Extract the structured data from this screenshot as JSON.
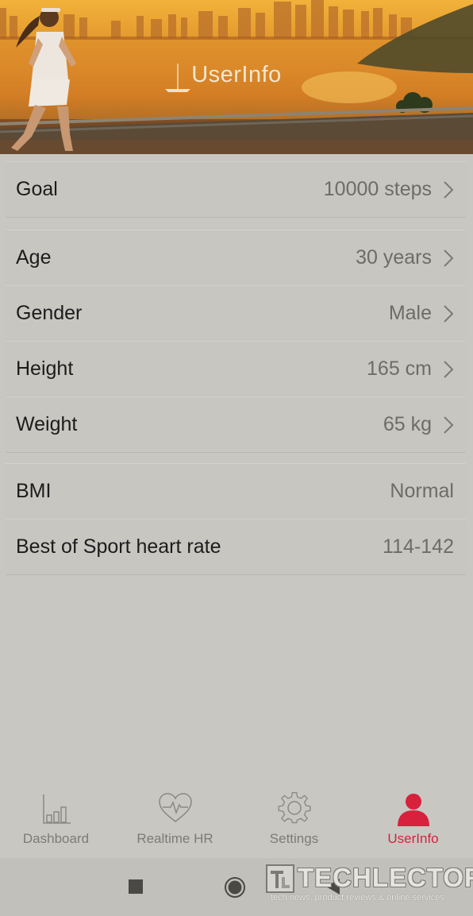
{
  "header": {
    "title": "UserInfo"
  },
  "goal_section": [
    {
      "label": "Goal",
      "value": "10000 steps"
    }
  ],
  "profile_section": [
    {
      "label": "Age",
      "value": "30 years"
    },
    {
      "label": "Gender",
      "value": "Male"
    },
    {
      "label": "Height",
      "value": "165 cm"
    },
    {
      "label": "Weight",
      "value": "65 kg"
    }
  ],
  "info_section": [
    {
      "label": "BMI",
      "value": "Normal"
    },
    {
      "label": "Best of Sport heart rate",
      "value": "114-142"
    }
  ],
  "tabs": [
    {
      "label": "Dashboard",
      "icon": "bar-chart-icon",
      "active": false
    },
    {
      "label": "Realtime HR",
      "icon": "heart-pulse-icon",
      "active": false
    },
    {
      "label": "Settings",
      "icon": "gear-icon",
      "active": false
    },
    {
      "label": "UserInfo",
      "icon": "user-icon",
      "active": true
    }
  ],
  "colors": {
    "accent": "#d8213d",
    "background": "#c9c7c2"
  },
  "watermark": {
    "brand": "TECHLECTOR",
    "tagline": "tech news, product reviews & online services"
  }
}
